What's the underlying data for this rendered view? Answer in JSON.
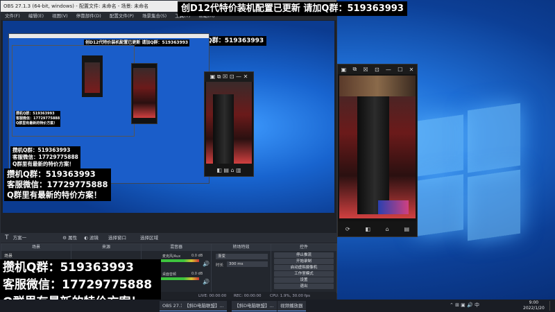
{
  "top_banner": {
    "text": "创D12代特价装机配置已更新 请加Q群：519363993"
  },
  "promo": {
    "line1": "攒机Q群：519363993",
    "line2": "客服微信：17729775888",
    "line3": "Q群里有最新的特价方案！"
  },
  "obs": {
    "title": "OBS 27.1.3 (64-bit, windows) - 配置文件: 未命名 - 场景: 未命名",
    "menu": [
      "文件(F)",
      "编辑(E)",
      "视图(V)",
      "停靠部件(D)",
      "配置文件(P)",
      "场景集合(S)",
      "工具(T)",
      "帮助(H)"
    ],
    "dock_toolbar": {
      "source_name": "方案一",
      "properties": "属性",
      "filters": "滤镜",
      "select_window": "选择窗口",
      "select_region": "选择区域"
    },
    "dock_headers": {
      "scenes": "场景",
      "sources": "来源",
      "mixer": "混音器",
      "transitions": "转场特效",
      "controls": "控件"
    },
    "scenes_item": "场景",
    "mixer": {
      "track1": "麦克风/Aux",
      "db1": "0.0 dB",
      "track2": "桌面音频",
      "db2": "0.0 dB"
    },
    "transitions": {
      "type": "渐变",
      "duration_label": "时长",
      "duration_value": "300 ms"
    },
    "controls": [
      "停止推流",
      "开始录制",
      "启动虚拟摄像机",
      "工作室模式",
      "设置",
      "退出"
    ],
    "status": {
      "live": "LIVE: 00:00:00",
      "rec": "REC: 00:00:00",
      "cpu": "CPU: 1.9%, 30.00 fps"
    }
  },
  "taskbar": {
    "items": [
      "OBS 27.1.3 (64-bi...",
      "【斜D电脑联盟】...",
      "【斜D电脑联盟】...",
      "视频播放器"
    ],
    "time": "9:00",
    "date": "2022/1/20"
  },
  "colors": {
    "desktop_blue": "#1f6fd6",
    "obs_dark": "#1e2127",
    "banner_bg": "#000000",
    "meter_green": "#3ec43e"
  }
}
